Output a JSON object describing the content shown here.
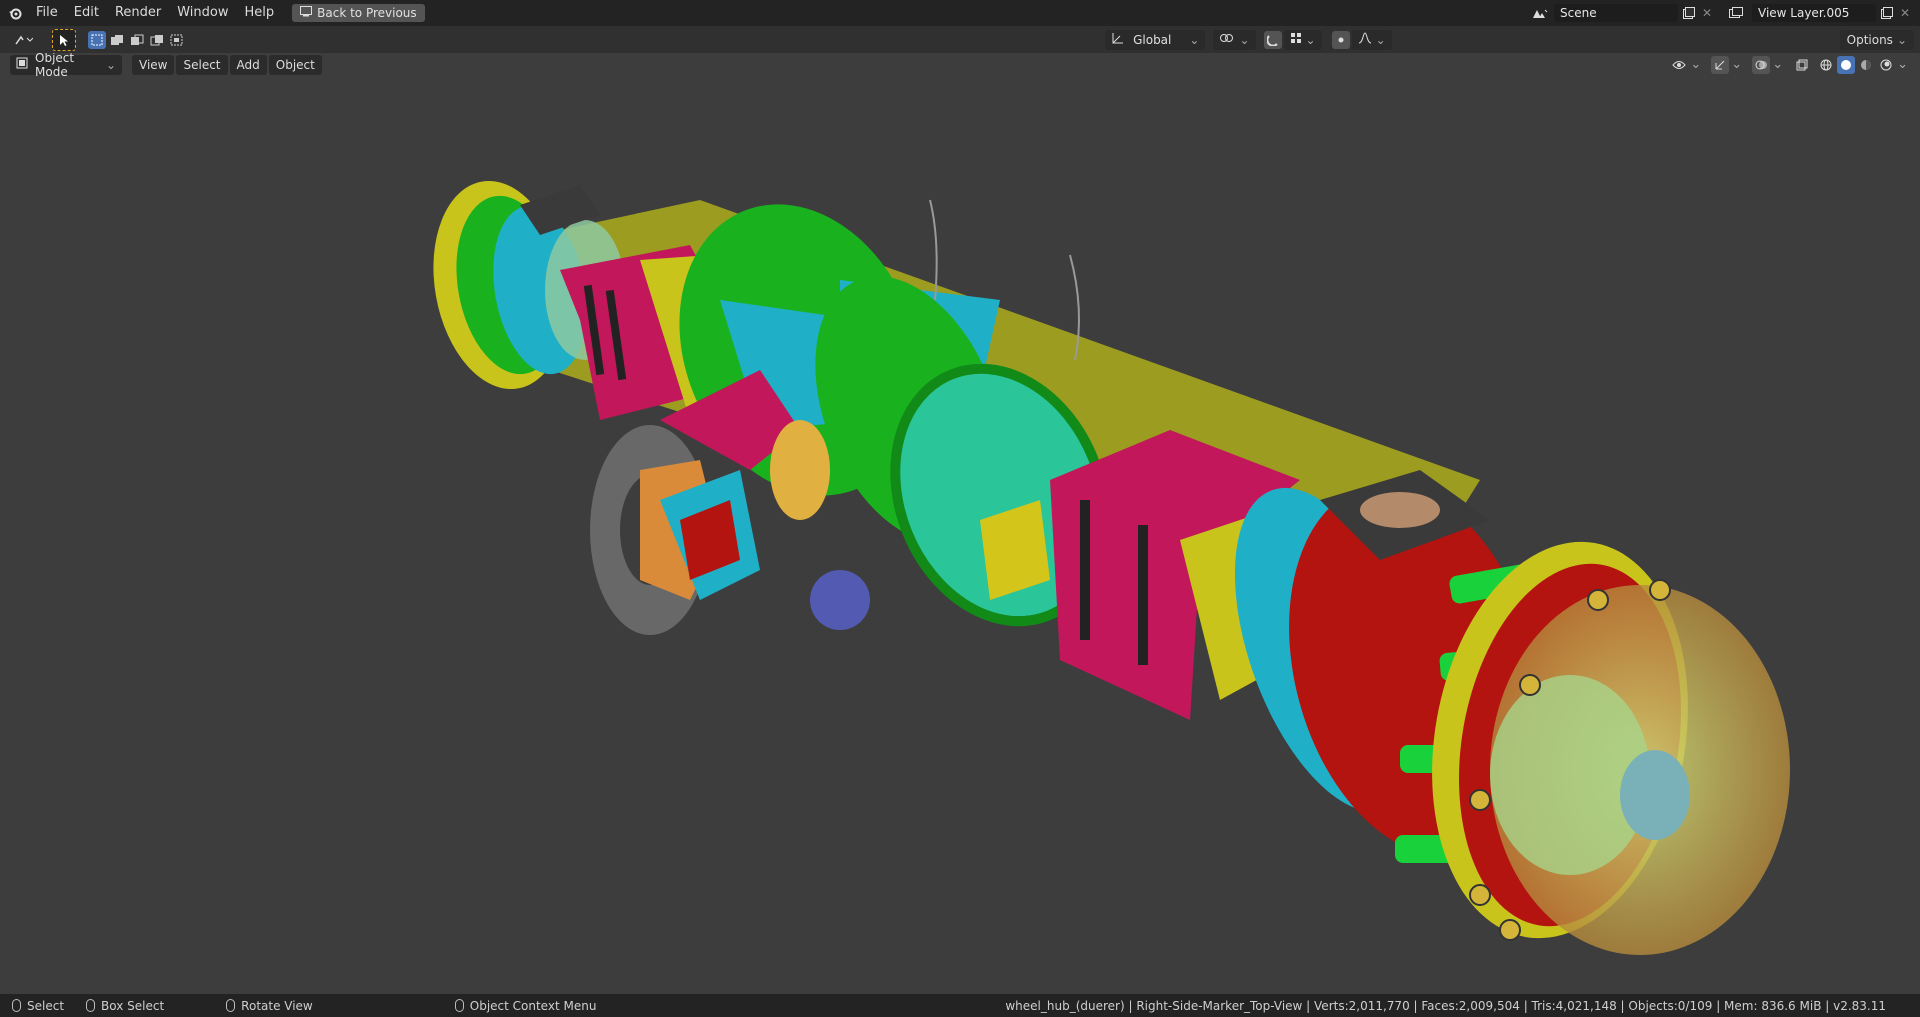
{
  "topbar": {
    "menus": [
      "File",
      "Edit",
      "Render",
      "Window",
      "Help"
    ],
    "back_button": "Back to Previous",
    "scene_label": "Scene",
    "view_layer_label": "View Layer.005"
  },
  "toolrow": {
    "transform_orientation": "Global",
    "options_label": "Options"
  },
  "viewport_header": {
    "mode": "Object Mode",
    "menus": [
      "View",
      "Select",
      "Add",
      "Object"
    ]
  },
  "statusbar": {
    "select": "Select",
    "box_select": "Box Select",
    "rotate_view": "Rotate View",
    "context_menu": "Object Context Menu",
    "stats": "wheel_hub_(duerer) | Right-Side-Marker_Top-View | Verts:2,011,770 | Faces:2,009,504 | Tris:4,021,148 | Objects:0/109 | Mem: 836.6 MiB | v2.83.11"
  },
  "colors": {
    "magenta": "#c2185b",
    "green": "#19b21e",
    "cyan": "#1fb0c7",
    "yellow": "#c9c41c",
    "red": "#b3140f",
    "teal": "#2bc59a",
    "orange": "#d98b3a",
    "tan": "#b58a3c",
    "selection": "#4772b3"
  },
  "icons": [
    "blender-logo-icon",
    "back-icon",
    "scene-icon",
    "copy-icon",
    "close-icon",
    "view-layer-icon",
    "editor-type-icon",
    "select-tool-icon",
    "transform-orientation-icon",
    "pivot-icon",
    "snap-icon",
    "snap-grid-icon",
    "proportional-icon",
    "falloff-icon",
    "object-mode-icon",
    "visibility-icon",
    "gizmo-icon",
    "overlay-icon",
    "xray-icon",
    "shading-wireframe-icon",
    "shading-solid-icon",
    "shading-material-icon",
    "shading-rendered-icon",
    "mouse-left-icon",
    "mouse-middle-icon",
    "mouse-right-icon"
  ]
}
